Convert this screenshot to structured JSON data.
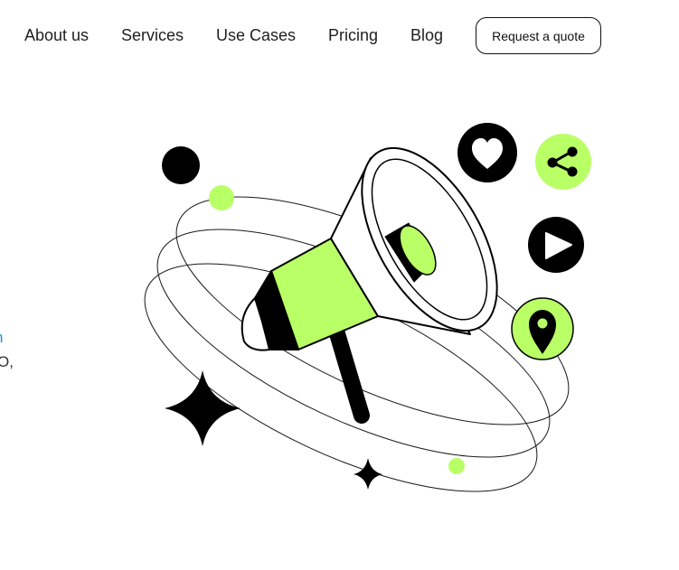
{
  "nav": {
    "items": [
      {
        "label": "About us"
      },
      {
        "label": "Services"
      },
      {
        "label": "Use Cases"
      },
      {
        "label": "Pricing"
      },
      {
        "label": "Blog"
      }
    ],
    "cta_label": "Request a quote"
  },
  "hero": {
    "fragment_link": "n",
    "fragment_text": "O,"
  },
  "illustration": {
    "main_subject": "megaphone-icon",
    "social_icons": [
      "heart-icon",
      "share-icon",
      "play-icon",
      "location-pin-icon"
    ],
    "accent_color": "#b9ff66",
    "ink_color": "#000000"
  }
}
